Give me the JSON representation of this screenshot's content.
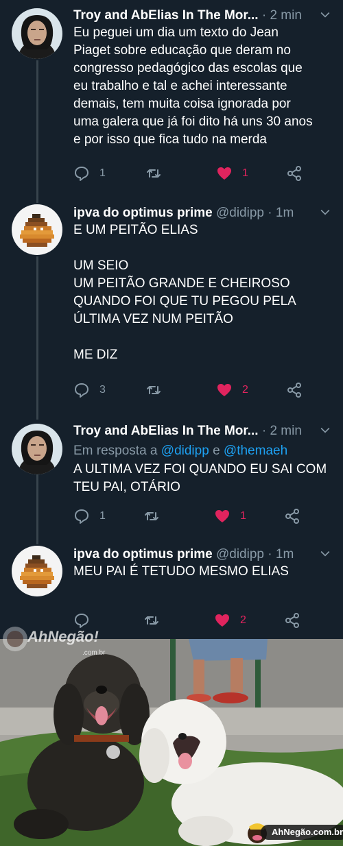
{
  "tweets": [
    {
      "author_name": "Troy and AbElias In The Mor...",
      "handle": "",
      "time": "2 min",
      "reply_prefix": "",
      "reply_mentions": [],
      "reply_joiner": "",
      "text": "Eu peguei um dia um texto do Jean\nPiaget sobre educação que deram no\ncongresso pedagógico das escolas que\neu trabalho e tal e achei interessante\ndemais, tem muita coisa ignorada por\numa galera que já foi dito há uns 30 anos\ne por isso que fica tudo na merda",
      "replies": "1",
      "retweets": "",
      "likes": "1",
      "liked": true
    },
    {
      "author_name": "ipva do optimus prime",
      "handle": "@didipp",
      "time": "1m",
      "text": "E UM PEITÃO ELIAS\n\nUM SEIO\nUM PEITÃO GRANDE E CHEIROSO\nQUANDO FOI QUE TU PEGOU PELA\nÚLTIMA VEZ NUM PEITÃO\n\nME DIZ",
      "replies": "3",
      "retweets": "",
      "likes": "2",
      "liked": true
    },
    {
      "author_name": "Troy and AbElias In The Mor...",
      "handle": "",
      "time": "2 min",
      "reply_prefix": "Em resposta a",
      "reply_mentions": [
        "@didipp",
        "@themaeh"
      ],
      "reply_joiner": "e",
      "text": "A ULTIMA VEZ FOI QUANDO EU SAI COM\nTEU PAI, OTÁRIO",
      "replies": "1",
      "retweets": "",
      "likes": "1",
      "liked": true
    },
    {
      "author_name": "ipva do optimus prime",
      "handle": "@didipp",
      "time": "1m",
      "text": "MEU PAI É TETUDO MESMO ELIAS",
      "replies": "",
      "retweets": "",
      "likes": "2",
      "liked": true
    }
  ],
  "watermark": {
    "top_text": "AhNegão!",
    "top_sub": ".com.br",
    "bottom_text": "AhNegão.com.br"
  },
  "colors": {
    "background": "#15202b",
    "secondary_text": "#8899a6",
    "link": "#1da1f2",
    "like": "#e0245e",
    "divider": "#38444d"
  },
  "icons": [
    "reply-icon",
    "retweet-icon",
    "heart-icon",
    "share-icon",
    "chevron-down-icon"
  ]
}
